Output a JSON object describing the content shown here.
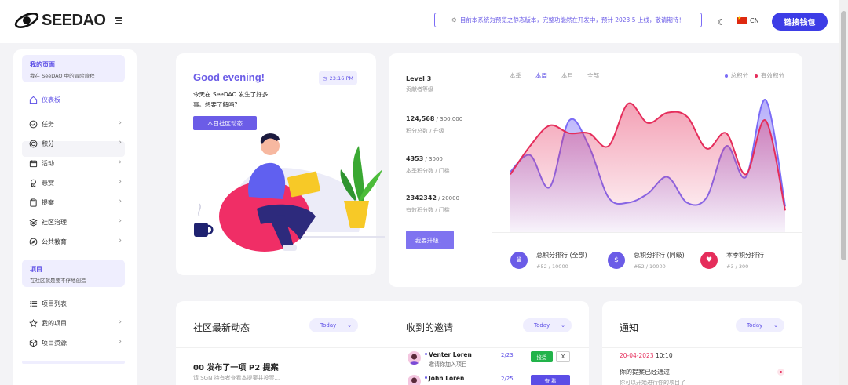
{
  "header": {
    "brand": "SEEDAO",
    "notice": "目前本系统为预览之静态版本，完整功能然在开发中，预计 2023.5 上线，敬请期待！",
    "lang": "CN",
    "connect_wallet": "链接钱包"
  },
  "sidebar": {
    "my_page": {
      "title": "我的页面",
      "subtitle": "我在 SeeDAO 中的冒险旅程"
    },
    "items": [
      {
        "label": "仪表板",
        "icon": "home-icon"
      },
      {
        "label": "任务",
        "icon": "check-circle-icon"
      },
      {
        "label": "积分",
        "icon": "coin-icon"
      },
      {
        "label": "活动",
        "icon": "calendar-icon"
      },
      {
        "label": "悬赏",
        "icon": "award-icon"
      },
      {
        "label": "提案",
        "icon": "clipboard-icon"
      },
      {
        "label": "社区治理",
        "icon": "layers-icon"
      },
      {
        "label": "公共教育",
        "icon": "compass-icon"
      }
    ],
    "project": {
      "title": "项目",
      "subtitle": "在社区就是要不停地创造"
    },
    "project_items": [
      {
        "label": "项目列表",
        "icon": "list-icon"
      },
      {
        "label": "我的项目",
        "icon": "star-icon"
      },
      {
        "label": "项目资源",
        "icon": "cube-icon"
      }
    ]
  },
  "greeting": {
    "title": "Good evening!",
    "time": "23:16 PM",
    "text_line1": "今天在 SeeDAO 发生了好多",
    "text_line2": "事。想要了解吗？",
    "button": "本日社区动态"
  },
  "stats": {
    "level": "Level 3",
    "level_sub": "贡献者等级",
    "items": [
      {
        "value": "124,568",
        "max": " / 300,000",
        "label": "积分总数 / 升级"
      },
      {
        "value": "4353",
        "max": " / 3000",
        "label": "本季积分数 / 门槛"
      },
      {
        "value": "2342342",
        "max": " / 20000",
        "label": "有效积分数 / 门槛"
      }
    ],
    "upgrade": "我要升级！"
  },
  "chart_tabs": [
    "本季",
    "本周",
    "本月",
    "全部"
  ],
  "chart_legend": {
    "total": "总积分",
    "valid": "有效积分"
  },
  "colors": {
    "accent": "#5b4de6",
    "series_total": "#7b6cf6",
    "series_valid": "#e52d5b"
  },
  "chart_data": {
    "type": "area",
    "series": [
      {
        "name": "总积分",
        "values": [
          0.42,
          0.55,
          0.3,
          0.82,
          0.62,
          0.22,
          0.18,
          0.25,
          0.38,
          0.18,
          0.22,
          0.62,
          0.38,
          0.98,
          0.15
        ]
      },
      {
        "name": "有效积分",
        "values": [
          0.4,
          0.62,
          0.78,
          0.72,
          0.72,
          0.62,
          0.95,
          0.8,
          0.88,
          0.85,
          0.6,
          0.72,
          0.4,
          0.82,
          0.12
        ]
      }
    ],
    "grid": false
  },
  "ranks": [
    {
      "title": "总积分排行 (全部)",
      "sub": "#52 / 10000",
      "icon": "crown-icon"
    },
    {
      "title": "总积分排行 (同级)",
      "sub": "#52 / 10000",
      "icon": "dollar-icon"
    },
    {
      "title": "本季积分排行",
      "sub": "#3 / 300",
      "icon": "heart-icon"
    }
  ],
  "activity": {
    "title": "社区最新动态",
    "filter": "Today",
    "item_title": "00 发布了一项 P2 提案",
    "item_sub": "请 SGN 持有者查看本提案并投票..."
  },
  "invites": {
    "title": "收到的邀请",
    "filter": "Today",
    "items": [
      {
        "name": "Venter Loren",
        "sub": "邀请你加入项目",
        "count": "2/23",
        "accept": "接受",
        "reject": "X"
      },
      {
        "name": "John Loren",
        "count": "2/25",
        "view": "查  看"
      }
    ]
  },
  "notify": {
    "title": "通知",
    "filter": "Today",
    "date": "20-04-2023",
    "time": "10:10",
    "item_title": "你的提案已经通过",
    "item_sub": "你可以开始进行你的项目了"
  }
}
